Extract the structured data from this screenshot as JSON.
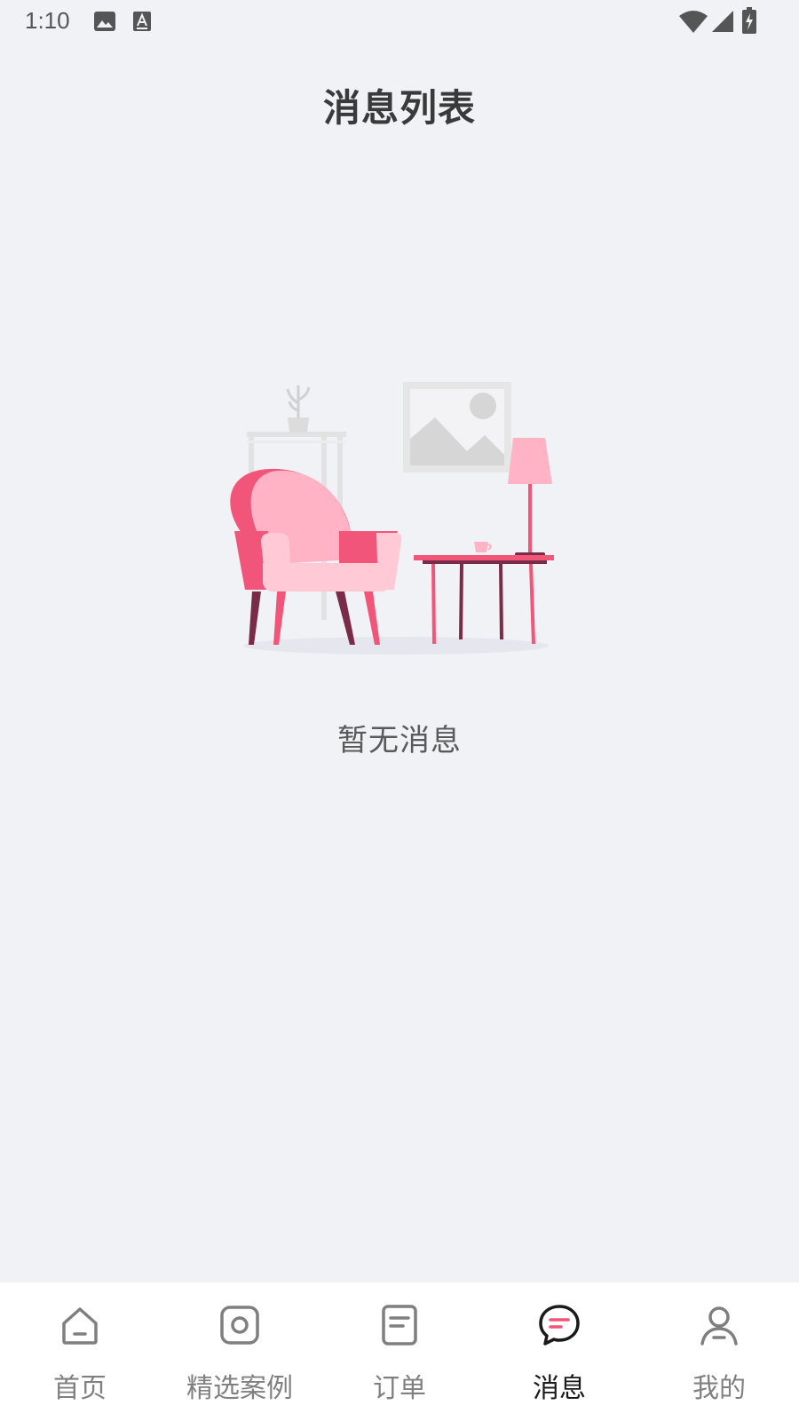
{
  "status_bar": {
    "time": "1:10",
    "icons": [
      "image-icon",
      "text-a-icon",
      "wifi-icon",
      "signal-icon",
      "battery-charging-icon"
    ]
  },
  "header": {
    "title": "消息列表"
  },
  "empty_state": {
    "illustration": "armchair-room-illustration",
    "message": "暂无消息"
  },
  "tab_bar": {
    "active_index": 3,
    "active_accent": "#f2557a",
    "items": [
      {
        "label": "首页",
        "icon": "home-icon"
      },
      {
        "label": "精选案例",
        "icon": "showcase-icon"
      },
      {
        "label": "订单",
        "icon": "order-icon"
      },
      {
        "label": "消息",
        "icon": "message-icon"
      },
      {
        "label": "我的",
        "icon": "profile-icon"
      }
    ]
  },
  "colors": {
    "background": "#f1f2f6",
    "tab_bar_bg": "#ffffff",
    "accent_pink": "#f2557a",
    "chair_light_pink": "#ffb3c4",
    "table_dark": "#7a2b45"
  }
}
